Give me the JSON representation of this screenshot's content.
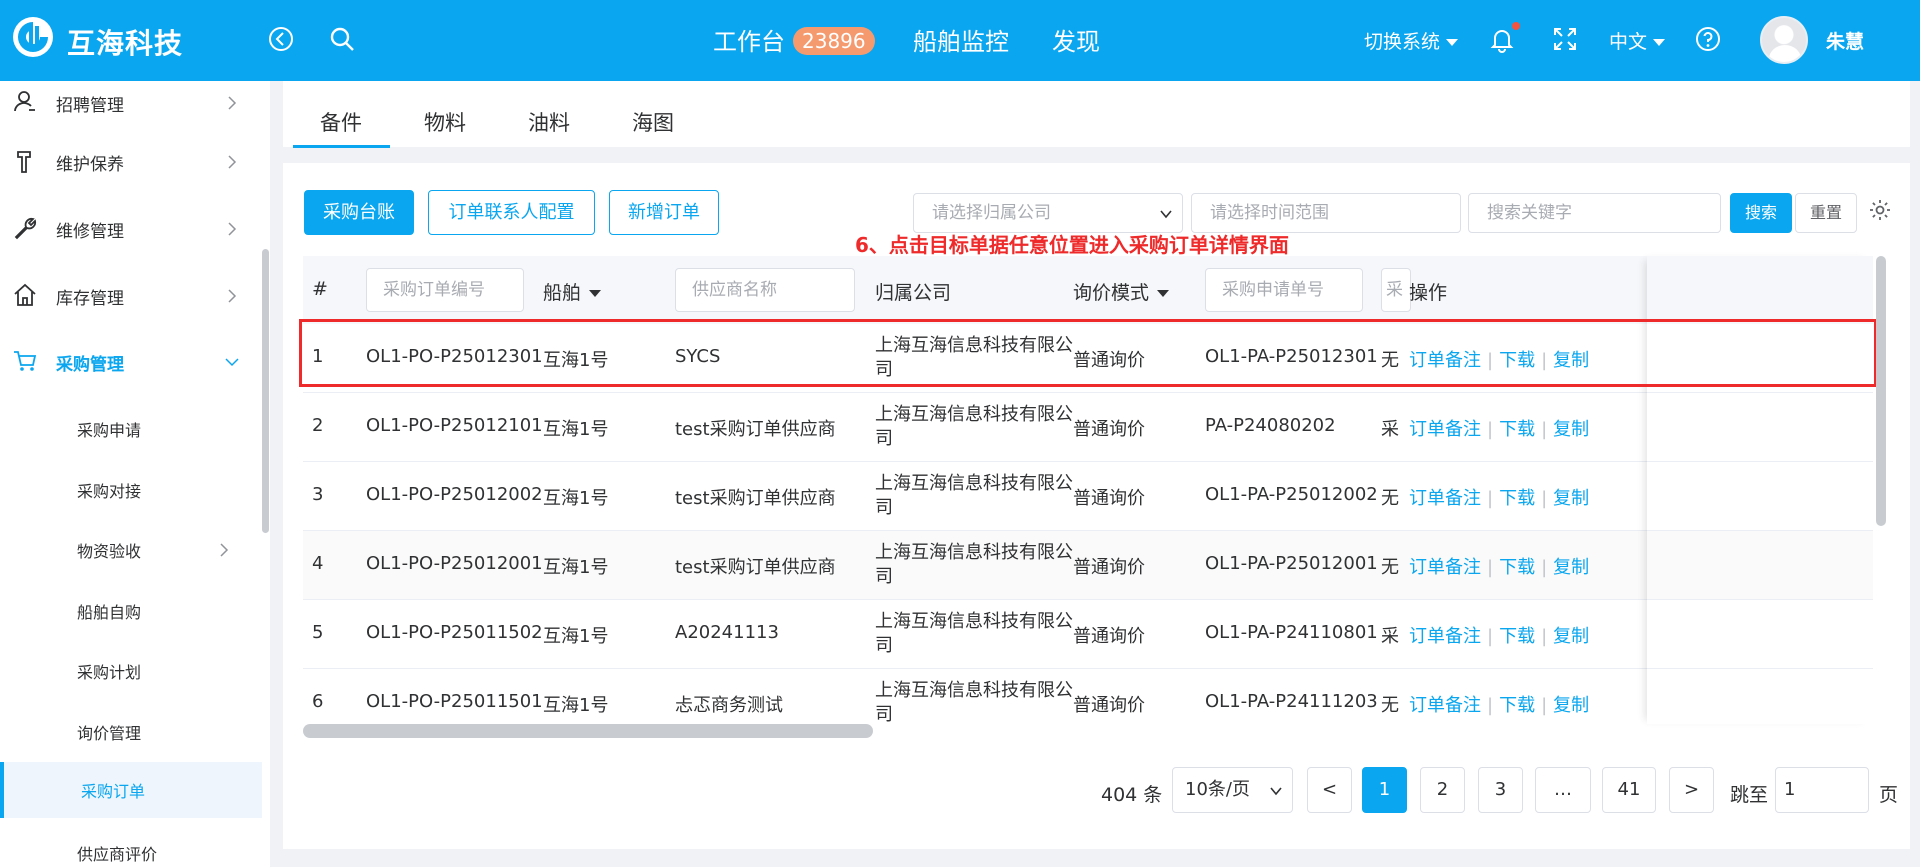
{
  "header": {
    "brand": "互海科技",
    "nav": [
      {
        "label": "工作台",
        "badge": "23896"
      },
      {
        "label": "船舶监控"
      },
      {
        "label": "发现"
      }
    ],
    "switch_system": "切换系统",
    "language": "中文",
    "username": "朱慧"
  },
  "sidebar": {
    "items": [
      {
        "label": "招聘管理",
        "icon": "user-icon"
      },
      {
        "label": "维护保养",
        "icon": "hammer-icon"
      },
      {
        "label": "维修管理",
        "icon": "wrench-icon"
      },
      {
        "label": "库存管理",
        "icon": "home-icon"
      },
      {
        "label": "采购管理",
        "icon": "cart-icon",
        "expanded": true
      }
    ],
    "sub_items": [
      {
        "label": "采购申请"
      },
      {
        "label": "采购对接"
      },
      {
        "label": "物资验收",
        "has_children": true
      },
      {
        "label": "船舶自购"
      },
      {
        "label": "采购计划"
      },
      {
        "label": "询价管理"
      },
      {
        "label": "采购订单",
        "selected": true
      },
      {
        "label": "供应商评价"
      }
    ]
  },
  "tabs": [
    "备件",
    "物料",
    "油料",
    "海图"
  ],
  "active_tab": "备件",
  "toolbar": {
    "ledger_button": "采购台账",
    "contact_config_button": "订单联系人配置",
    "add_order_button": "新增订单",
    "company_placeholder": "请选择归属公司",
    "time_placeholder": "请选择时间范围",
    "keyword_placeholder": "搜索关键字",
    "search_button": "搜索",
    "reset_button": "重置"
  },
  "annotation": "6、点击目标单据任意位置进入采购订单详情界面",
  "table": {
    "headers": {
      "index": "#",
      "order_no_placeholder": "采购订单编号",
      "ship": "船舶",
      "supplier_placeholder": "供应商名称",
      "company": "归属公司",
      "inquiry_mode": "询价模式",
      "request_no_placeholder": "采购申请单号",
      "partial_col": "采",
      "operations": "操作"
    },
    "rows": [
      {
        "index": "1",
        "order_no": "OL1-PO-P25012301",
        "ship": "互海1号",
        "supplier": "SYCS",
        "company": "上海互海信息科技有限公司",
        "mode": "普通询价",
        "request_no": "OL1-PA-P25012301",
        "partial": "无"
      },
      {
        "index": "2",
        "order_no": "OL1-PO-P25012101",
        "ship": "互海1号",
        "supplier": "test采购订单供应商",
        "company": "上海互海信息科技有限公司",
        "mode": "普通询价",
        "request_no": "PA-P24080202",
        "partial": "采"
      },
      {
        "index": "3",
        "order_no": "OL1-PO-P25012002",
        "ship": "互海1号",
        "supplier": "test采购订单供应商",
        "company": "上海互海信息科技有限公司",
        "mode": "普通询价",
        "request_no": "OL1-PA-P25012002",
        "partial": "无"
      },
      {
        "index": "4",
        "order_no": "OL1-PO-P25012001",
        "ship": "互海1号",
        "supplier": "test采购订单供应商",
        "company": "上海互海信息科技有限公司",
        "mode": "普通询价",
        "request_no": "OL1-PA-P25012001",
        "partial": "无"
      },
      {
        "index": "5",
        "order_no": "OL1-PO-P25011502",
        "ship": "互海1号",
        "supplier": "A20241113",
        "company": "上海互海信息科技有限公司",
        "mode": "普通询价",
        "request_no": "OL1-PA-P24110801",
        "partial": "采"
      },
      {
        "index": "6",
        "order_no": "OL1-PO-P25011501",
        "ship": "互海1号",
        "supplier": "忐忑商务测试",
        "company": "上海互海信息科技有限公司",
        "mode": "普通询价",
        "request_no": "OL1-PA-P24111203",
        "partial": "无"
      }
    ],
    "row_actions": [
      "订单备注",
      "下载",
      "复制"
    ]
  },
  "pagination": {
    "total": "404 条",
    "page_size": "10条/页",
    "prev": "<",
    "pages": [
      "1",
      "2",
      "3",
      "…",
      "41"
    ],
    "current": "1",
    "next": ">",
    "jump_label": "跳至",
    "jump_value": "1",
    "page_unit": "页"
  },
  "colors": {
    "primary": "#0aa6ef",
    "annotation": "#ee2a2a"
  }
}
